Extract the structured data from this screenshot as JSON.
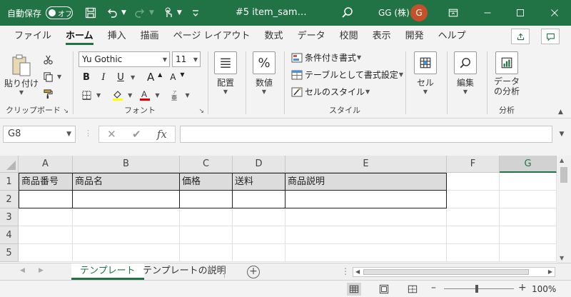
{
  "titlebar": {
    "autosave_label": "自動保存",
    "autosave_state": "オフ",
    "doc_title": "#5 item_sam…",
    "user_name": "GG (株)",
    "avatar_initial": "G",
    "accent": "#217346"
  },
  "tabs": [
    {
      "label": "ファイル"
    },
    {
      "label": "ホーム",
      "active": true
    },
    {
      "label": "挿入"
    },
    {
      "label": "描画"
    },
    {
      "label": "ページ レイアウト"
    },
    {
      "label": "数式"
    },
    {
      "label": "データ"
    },
    {
      "label": "校閲"
    },
    {
      "label": "表示"
    },
    {
      "label": "開発"
    },
    {
      "label": "ヘルプ"
    }
  ],
  "ribbon": {
    "clipboard": {
      "paste": "貼り付け",
      "group": "クリップボード"
    },
    "font": {
      "name": "Yu Gothic",
      "size": "11",
      "bold": "B",
      "italic": "I",
      "underline": "U",
      "grow": "A",
      "shrink": "A",
      "group": "フォント"
    },
    "align": {
      "label": "配置"
    },
    "number": {
      "symbol": "%",
      "label": "数値"
    },
    "styles": {
      "conditional": "条件付き書式",
      "table": "テーブルとして書式設定",
      "cell": "セルのスタイル",
      "group": "スタイル"
    },
    "cells": {
      "label": "セル"
    },
    "editing": {
      "label": "編集"
    },
    "analysis": {
      "label_line1": "データ",
      "label_line2": "の分析",
      "group": "分析"
    }
  },
  "formula_bar": {
    "name_box": "G8",
    "cancel": "✕",
    "enter": "✔",
    "fx": "fx",
    "value": ""
  },
  "grid": {
    "columns": [
      "A",
      "B",
      "C",
      "D",
      "E",
      "F",
      "G"
    ],
    "selected_column": "G",
    "rows": [
      "1",
      "2",
      "3",
      "4",
      "5"
    ],
    "header_cells": [
      "商品番号",
      "商品名",
      "価格",
      "送料",
      "商品説明"
    ]
  },
  "sheets": [
    {
      "label": "テンプレート",
      "active": true
    },
    {
      "label": "テンプレートの説明"
    }
  ],
  "status": {
    "zoom": "100%"
  }
}
